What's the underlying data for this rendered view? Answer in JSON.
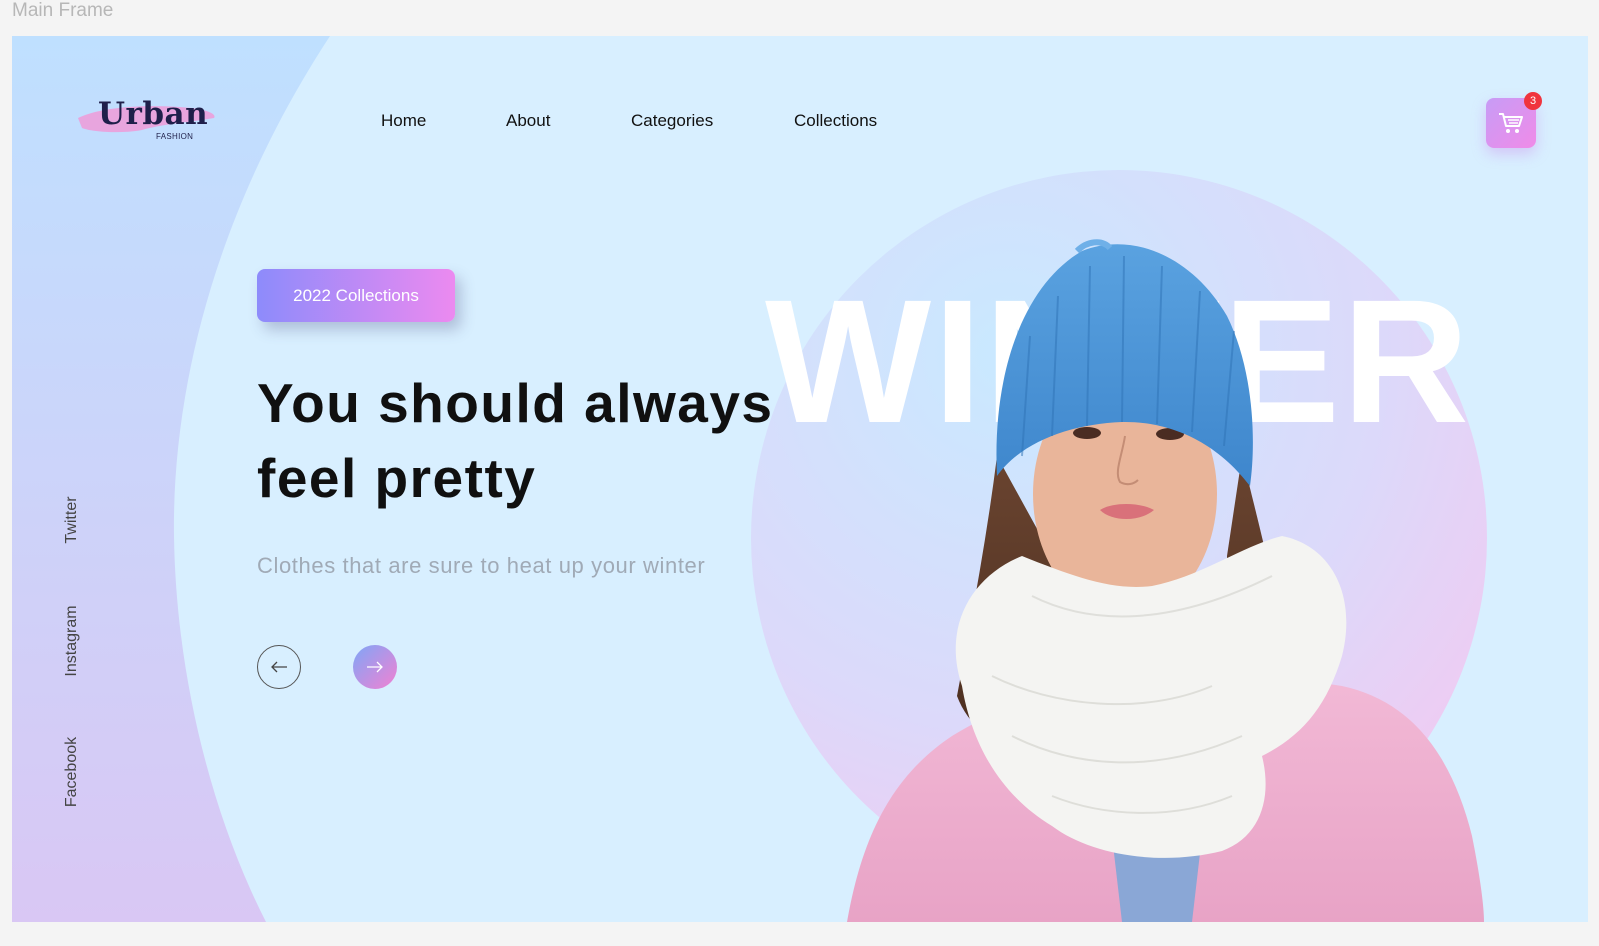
{
  "frame_title": "Main Frame",
  "logo": {
    "name": "Urban",
    "sub": "FASHION"
  },
  "nav": [
    "Home",
    "About",
    "Categories",
    "Collections"
  ],
  "cart": {
    "count": "3"
  },
  "social": [
    "Twitter",
    "Instagram",
    "Facebook"
  ],
  "hero": {
    "badge": "2022 Collections",
    "headline_line1": "You should always",
    "headline_line2": "feel pretty",
    "subtext": "Clothes that are sure to heat up your winter",
    "background_word": "WINTER"
  },
  "colors": {
    "page_bg": "#d8efff",
    "accent_gradient_start": "#8d8bfb",
    "accent_gradient_end": "#ec8af0",
    "badge_red": "#f0343e",
    "heading": "#101010",
    "muted": "#a0aab6"
  },
  "icons": {
    "cart": "shopping-cart-icon",
    "prev": "arrow-left-icon",
    "next": "arrow-right-icon"
  }
}
